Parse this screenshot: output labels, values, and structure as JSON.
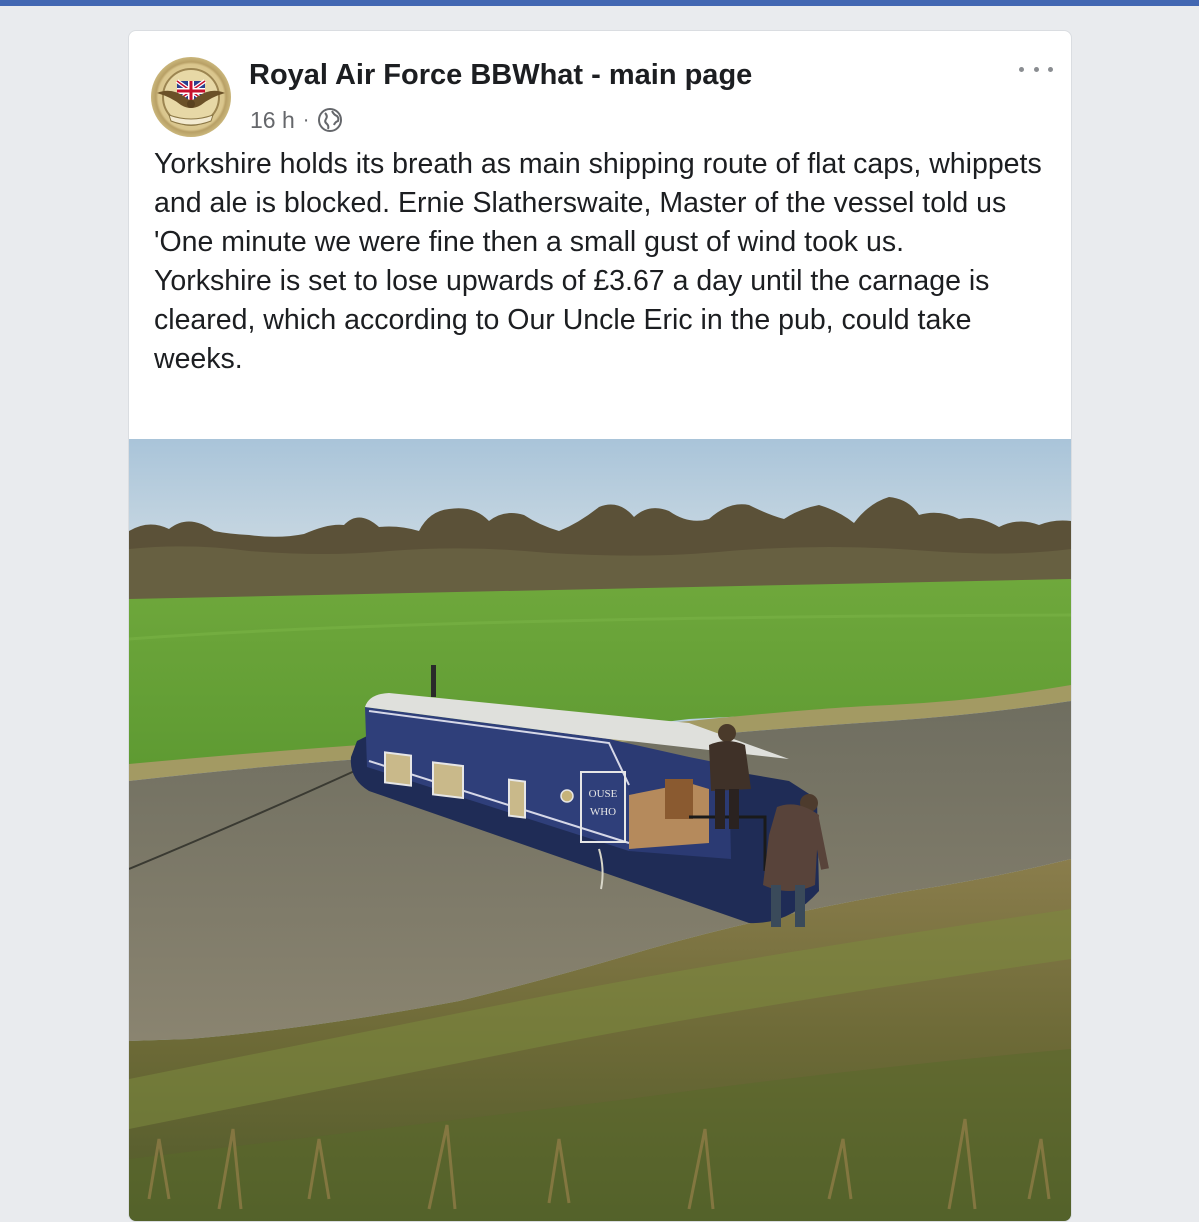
{
  "post": {
    "page_name": "Royal Air Force BBWhat - main page",
    "timestamp": "16 h",
    "separator": "·",
    "privacy_icon": "globe-icon",
    "more_icon": "more-options-icon",
    "text_paragraphs": [
      "Yorkshire holds its breath as main shipping route of flat caps, whippets and ale is blocked. Ernie Slatherswaite, Master of the vessel told us 'One minute we were fine then a small gust of wind took us.",
      "Yorkshire is set to lose upwards of £3.67 a day until the carnage is cleared, which according to Our Uncle Eric in the pub, could take weeks."
    ],
    "boat_name": "OUSE WHO"
  },
  "colors": {
    "top_bar": "#4267b2",
    "text": "#1c1e21",
    "secondary_text": "#65676b",
    "page_background": "#e9ebee"
  }
}
